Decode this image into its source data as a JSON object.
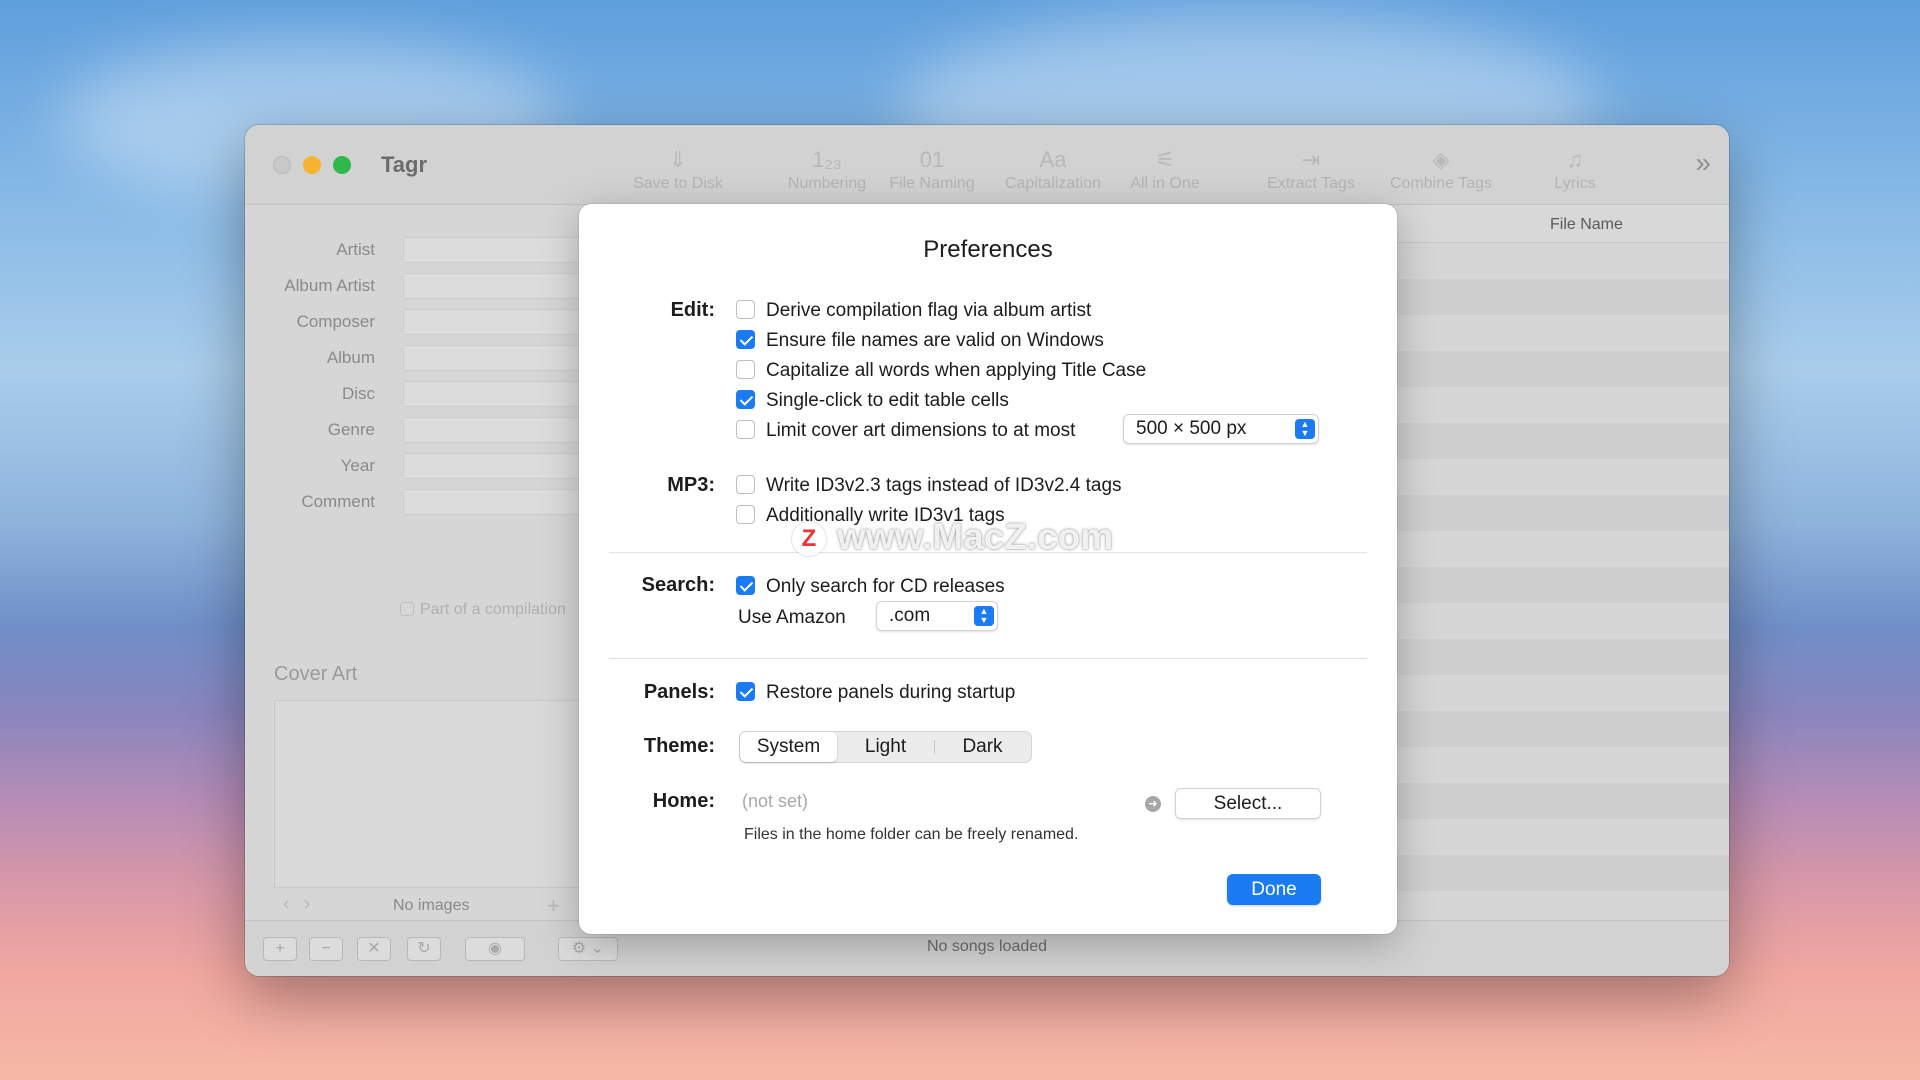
{
  "window": {
    "title": "Tagr",
    "toolbar": [
      {
        "label": "Save to Disk",
        "icon": "save-disk-icon",
        "glyph": "⇓"
      },
      {
        "label": "Numbering",
        "icon": "numbering-icon",
        "glyph": "1₂₃"
      },
      {
        "label": "File Naming",
        "icon": "file-naming-icon",
        "glyph": "01"
      },
      {
        "label": "Capitalization",
        "icon": "capitalization-icon",
        "glyph": "Aa"
      },
      {
        "label": "All in One",
        "icon": "all-in-one-icon",
        "glyph": "⚟"
      },
      {
        "label": "Extract Tags",
        "icon": "extract-tags-icon",
        "glyph": "⇥"
      },
      {
        "label": "Combine Tags",
        "icon": "combine-tags-icon",
        "glyph": "◈"
      },
      {
        "label": "Lyrics",
        "icon": "lyrics-icon",
        "glyph": "♫"
      }
    ],
    "more_glyph": "»"
  },
  "tag_fields": [
    "Artist",
    "Album Artist",
    "Composer",
    "Album",
    "Disc",
    "Genre",
    "Year",
    "Comment"
  ],
  "compilation_label": "Part of a compilation",
  "cover_art": {
    "title": "Cover Art",
    "empty_label": "No images",
    "prev": "‹",
    "next": "›",
    "add": "+"
  },
  "table": {
    "column": "File Name"
  },
  "bottom_bar": {
    "status": "No songs loaded",
    "buttons": [
      {
        "glyph": "+",
        "icon": "add-icon"
      },
      {
        "glyph": "−",
        "icon": "remove-icon"
      },
      {
        "glyph": "✕",
        "icon": "clear-icon"
      },
      {
        "glyph": "↻",
        "icon": "reload-icon"
      },
      {
        "glyph": "◉",
        "icon": "preview-eye-icon"
      },
      {
        "glyph": "⚙ ⌄",
        "icon": "gear-icon"
      }
    ]
  },
  "preferences": {
    "title": "Preferences",
    "edit": {
      "label": "Edit:",
      "options": [
        {
          "text": "Derive compilation flag via album artist",
          "checked": false
        },
        {
          "text": "Ensure file names are valid on Windows",
          "checked": true
        },
        {
          "text": "Capitalize all words when applying Title Case",
          "checked": false
        },
        {
          "text": "Single-click to edit table cells",
          "checked": true
        },
        {
          "text": "Limit cover art dimensions to at most",
          "checked": false
        }
      ],
      "dimension_value": "500 × 500 px"
    },
    "mp3": {
      "label": "MP3:",
      "options": [
        {
          "text": "Write ID3v2.3 tags instead of ID3v2.4 tags",
          "checked": false
        },
        {
          "text": "Additionally write ID3v1 tags",
          "checked": false
        }
      ]
    },
    "search": {
      "label": "Search:",
      "option": {
        "text": "Only search for CD releases",
        "checked": true
      },
      "amazon_label": "Use Amazon",
      "amazon_value": ".com"
    },
    "panels": {
      "label": "Panels:",
      "option": {
        "text": "Restore panels during startup",
        "checked": true
      }
    },
    "theme": {
      "label": "Theme:",
      "options": [
        "System",
        "Light",
        "Dark"
      ],
      "selected": "System"
    },
    "home": {
      "label": "Home:",
      "placeholder": "(not set)",
      "select_label": "Select...",
      "hint": "Files in the home folder can be freely renamed."
    },
    "done_label": "Done"
  },
  "watermark": {
    "text": "www.MacZ.com",
    "logo": "Z"
  },
  "colors": {
    "accent": "#1a7bf2",
    "close": "#c9c9c9",
    "minimize": "#f6b530",
    "maximize": "#2fb94a"
  }
}
